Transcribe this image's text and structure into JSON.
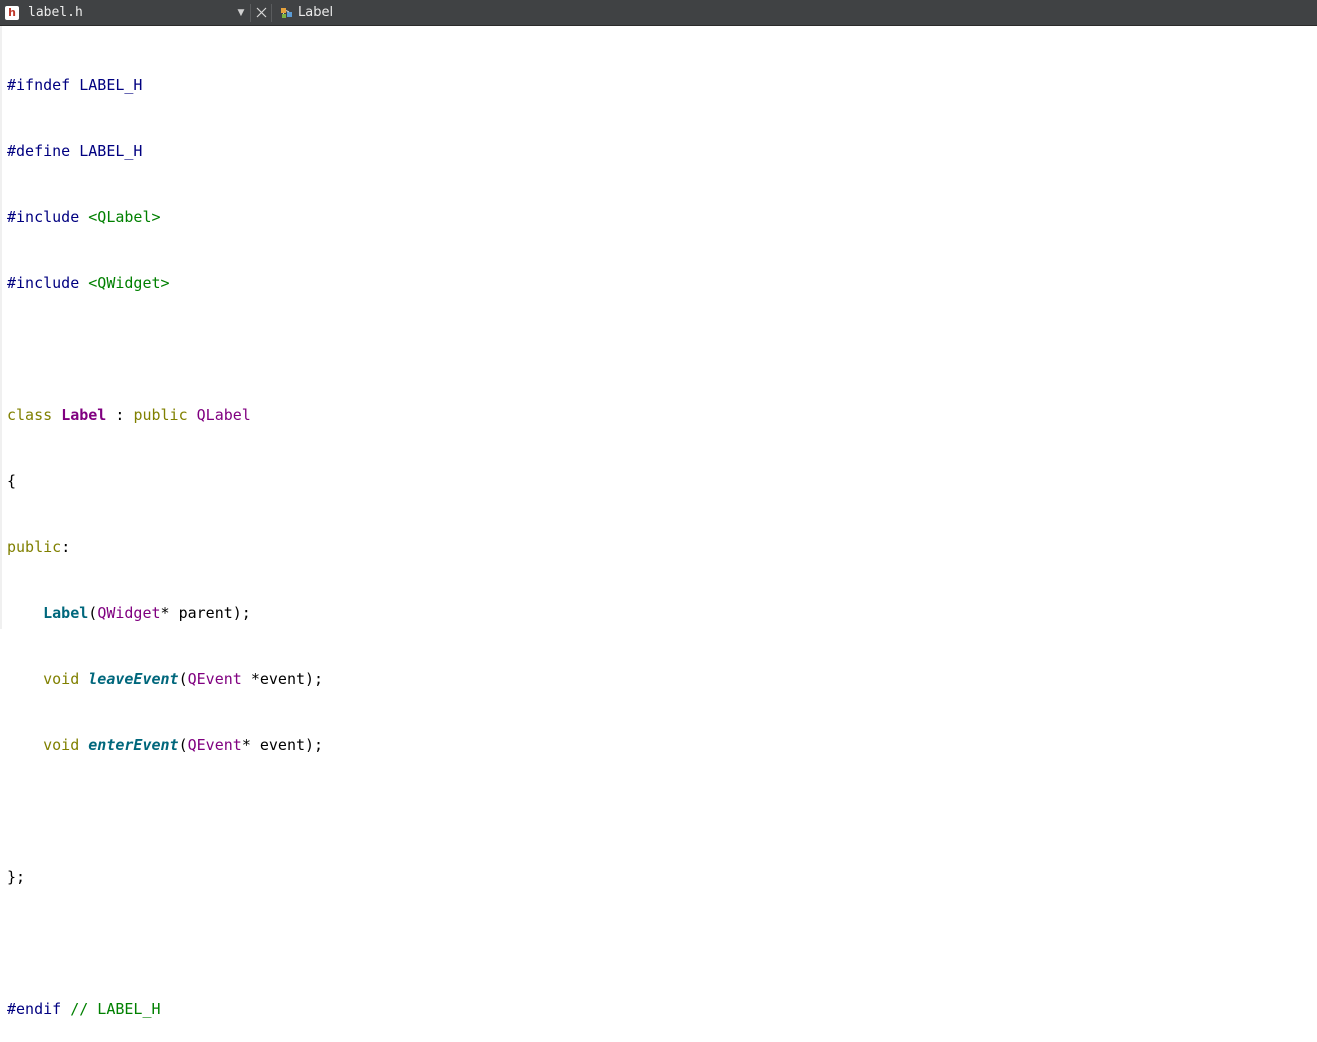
{
  "toolbar": {
    "file_icon_letter": "h",
    "file_name": "label.h",
    "dropdown_icon": "chevron-down-icon",
    "close_icon": "close-icon",
    "symbol_icon": "class-symbol-icon",
    "symbol_label": "Label"
  },
  "code": {
    "l1": {
      "a": "#ifndef LABEL_H"
    },
    "l2": {
      "a": "#define LABEL_H"
    },
    "l3": {
      "a": "#include ",
      "b": "<QLabel>"
    },
    "l4": {
      "a": "#include ",
      "b": "<QWidget>"
    },
    "l6": {
      "a": "class",
      "b": " ",
      "c": "Label",
      "d": " : ",
      "e": "public",
      "f": " ",
      "g": "QLabel"
    },
    "l7": {
      "a": "{"
    },
    "l8": {
      "a": "public",
      "b": ":"
    },
    "l9": {
      "indent": "    ",
      "a": "Label",
      "b": "(",
      "c": "QWidget",
      "d": "* parent);"
    },
    "l10": {
      "indent": "    ",
      "a": "void",
      "b": " ",
      "c": "leaveEvent",
      "d": "(",
      "e": "QEvent",
      "f": " *event);"
    },
    "l11": {
      "indent": "    ",
      "a": "void",
      "b": " ",
      "c": "enterEvent",
      "d": "(",
      "e": "QEvent",
      "f": "* event);"
    },
    "l13": {
      "a": "};"
    },
    "l15": {
      "a": "#endif",
      "b": " // LABEL_H"
    }
  }
}
